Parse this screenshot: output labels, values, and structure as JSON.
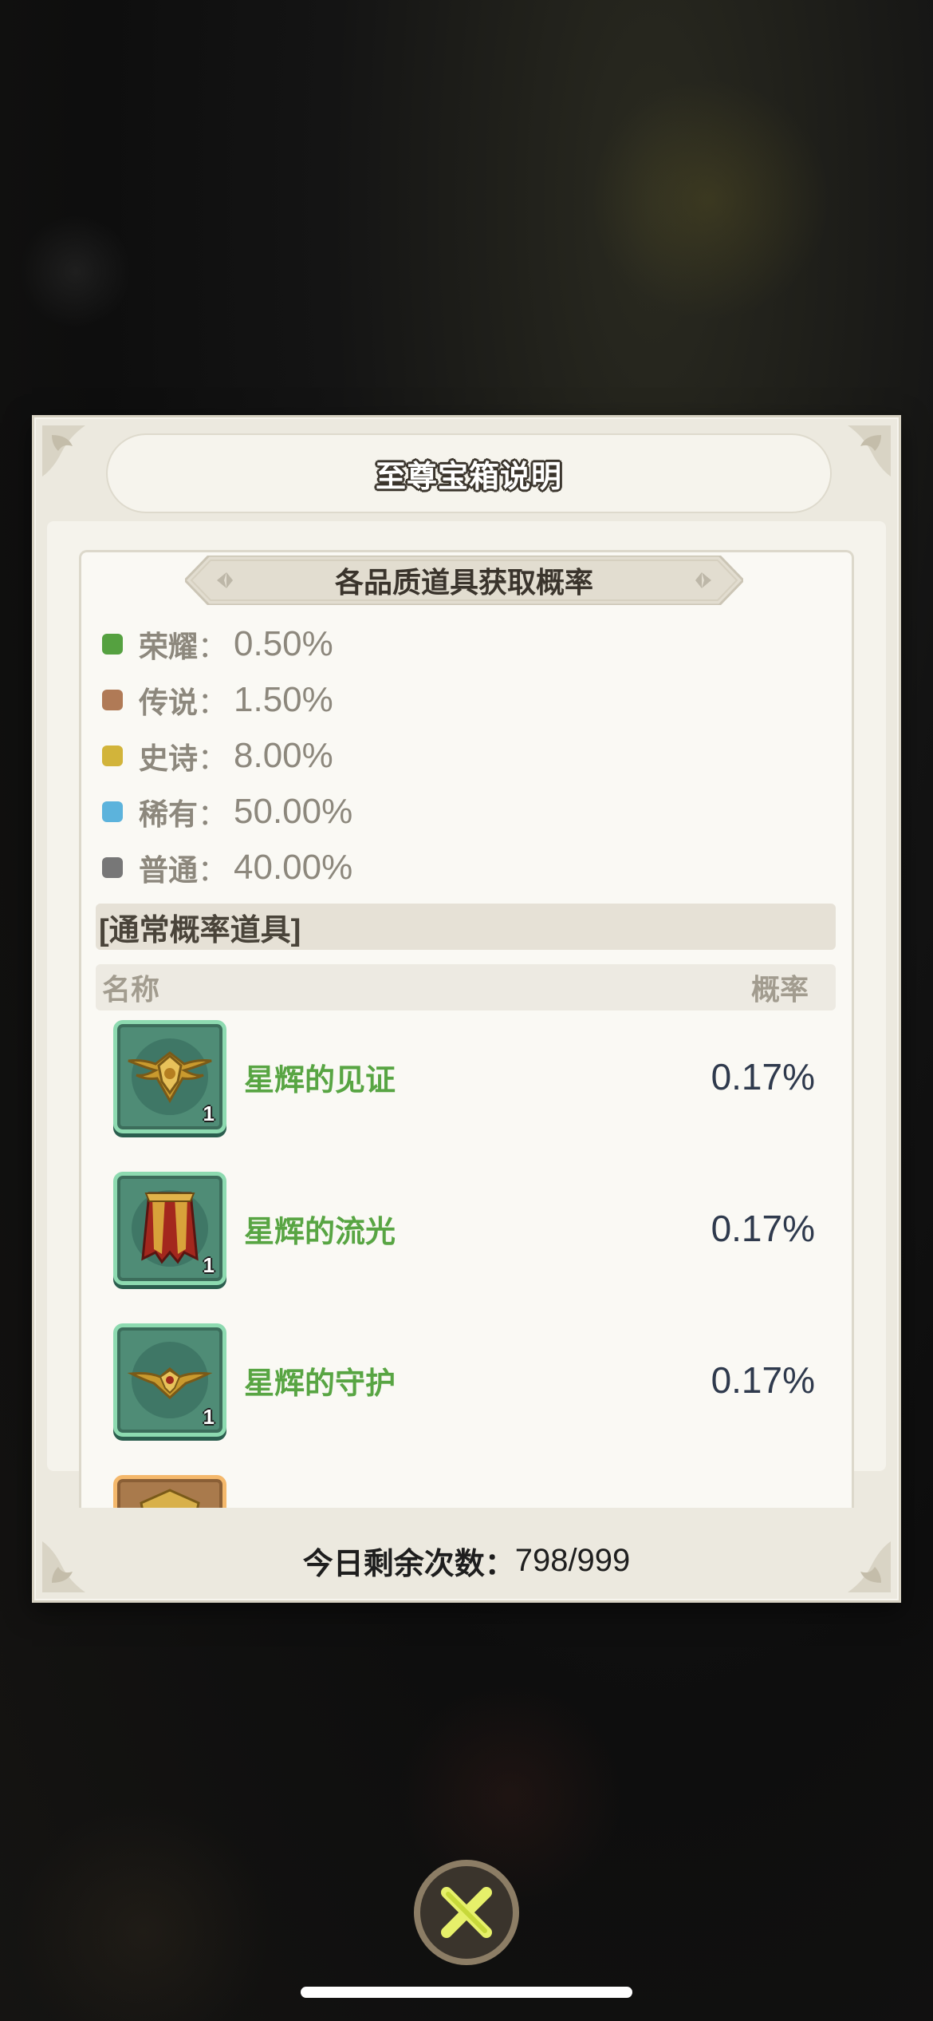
{
  "dialog": {
    "title": "至尊宝箱说明",
    "ribbon_title": "各品质道具获取概率",
    "qualities": [
      {
        "label": "荣耀",
        "sep": "：",
        "value": "0.50%",
        "color": "#55a140"
      },
      {
        "label": "传说",
        "sep": "：",
        "value": "1.50%",
        "color": "#b07a56"
      },
      {
        "label": "史诗",
        "sep": "：",
        "value": "8.00%",
        "color": "#d2b43a"
      },
      {
        "label": "稀有",
        "sep": "：",
        "value": "50.00%",
        "color": "#5cb3dc"
      },
      {
        "label": "普通",
        "sep": "：",
        "value": "40.00%",
        "color": "#777777"
      }
    ],
    "section_title": "[通常概率道具]",
    "table_header": {
      "name": "名称",
      "rate": "概率"
    },
    "items": [
      {
        "name": "星辉的见证",
        "rate": "0.17%",
        "count": "1",
        "icon": "winged-shield-emblem-icon"
      },
      {
        "name": "星辉的流光",
        "rate": "0.17%",
        "count": "1",
        "icon": "red-cape-icon"
      },
      {
        "name": "星辉的守护",
        "rate": "0.17%",
        "count": "1",
        "icon": "winged-crest-icon"
      }
    ],
    "footer": {
      "label": "今日剩余次数：",
      "value": "798/999"
    }
  },
  "close_button": {
    "icon": "close-x-icon"
  },
  "colors": {
    "green_name": "#58a543",
    "rate_text": "#2f3a4d",
    "panel_bg": "#faf9f4"
  }
}
